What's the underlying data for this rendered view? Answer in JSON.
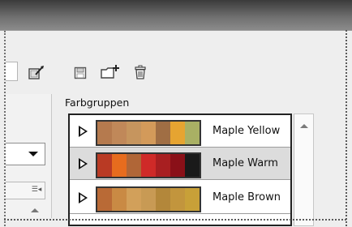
{
  "panel": {
    "title": "Farbgruppen"
  },
  "color_groups": [
    {
      "label": "Maple Yellow",
      "colors": [
        "#b57a4e",
        "#c08859",
        "#c6955e",
        "#d39a5a",
        "#a06e44",
        "#e6a431",
        "#a9b064"
      ]
    },
    {
      "label": "Maple Warm",
      "colors": [
        "#b93a24",
        "#e76c1e",
        "#b06637",
        "#cf2a28",
        "#a81f21",
        "#8a1018",
        "#1a1a1a"
      ]
    },
    {
      "label": "Maple Brown",
      "colors": [
        "#b96a36",
        "#c98a44",
        "#d2a05a",
        "#c89a54",
        "#b3873a",
        "#c2953d",
        "#c8a038"
      ]
    }
  ],
  "toolbar": {
    "icons": [
      "edit-color-group-icon",
      "save-icon",
      "new-folder-icon",
      "delete-icon"
    ]
  }
}
